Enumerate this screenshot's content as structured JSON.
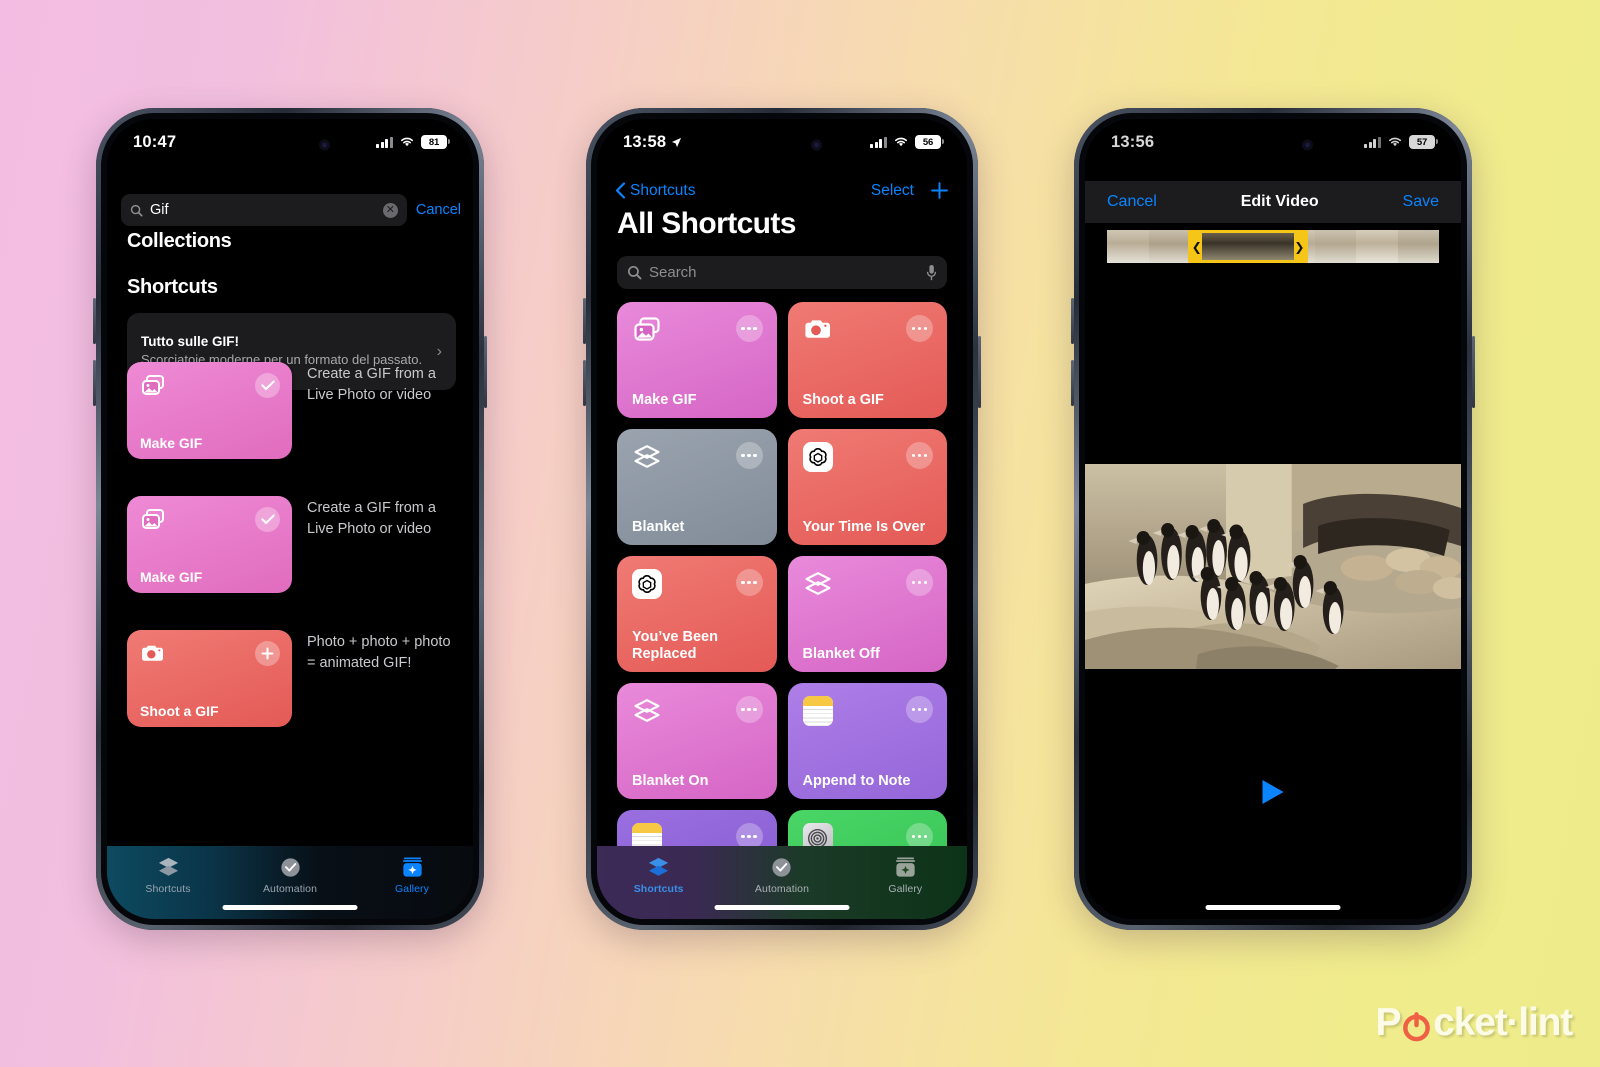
{
  "background": {
    "from": "#f3bde3",
    "to": "#f0ec8c"
  },
  "watermark": {
    "pre": "P",
    "post": "cket·lint",
    "accent": "#ef6144"
  },
  "phone1": {
    "status": {
      "time": "10:47",
      "battery": "81"
    },
    "search": {
      "value": "Gif",
      "cancel": "Cancel",
      "clear": "✕"
    },
    "collections_title": "Collections",
    "collection": {
      "name": "Tutto sulle GIF!",
      "description": "Scorciatoie moderne per un formato del passato.",
      "chevron": "›"
    },
    "shortcuts_title": "Shortcuts",
    "shortcuts": [
      {
        "name": "Make GIF",
        "description": "Create a GIF from a Live Photo or video",
        "color": "#e77cc8",
        "icon": "photos-stack-icon",
        "badge": "check"
      },
      {
        "name": "Make GIF",
        "description": "Create a GIF from a Live Photo or video",
        "color": "#e57fca",
        "icon": "photos-stack-icon",
        "badge": "check"
      },
      {
        "name": "Shoot a GIF",
        "description": "Photo + photo + photo = animated GIF!",
        "color": "#ec6763",
        "icon": "camera-icon",
        "badge": "plus"
      }
    ],
    "tabs": [
      {
        "label": "Shortcuts",
        "icon": "layers-icon",
        "active": false
      },
      {
        "label": "Automation",
        "icon": "clock-check-icon",
        "active": false
      },
      {
        "label": "Gallery",
        "icon": "gallery-sparkle-icon",
        "active": true
      }
    ]
  },
  "phone2": {
    "status": {
      "time": "13:58",
      "battery": "56"
    },
    "nav": {
      "back": "Shortcuts",
      "select": "Select",
      "add": "+"
    },
    "title": "All Shortcuts",
    "search_placeholder": "Search",
    "tiles": [
      {
        "name": "Make GIF",
        "color": "#e07ad2",
        "icon": "photos-stack-icon"
      },
      {
        "name": "Shoot a GIF",
        "color": "#ec6763",
        "icon": "camera-icon"
      },
      {
        "name": "Blanket",
        "color": "#8d96a3",
        "icon": "layers-icon"
      },
      {
        "name": "Your Time Is Over",
        "color": "#ec6763",
        "icon": "chatgpt-icon"
      },
      {
        "name": "You’ve Been Replaced",
        "color": "#ec6763",
        "icon": "chatgpt-icon"
      },
      {
        "name": "Blanket Off",
        "color": "#e07ad2",
        "icon": "layers-icon"
      },
      {
        "name": "Blanket On",
        "color": "#e07ad2",
        "icon": "layers-icon"
      },
      {
        "name": "Append to Note",
        "color": "#a471e0",
        "icon": "notes-icon"
      },
      {
        "name": "",
        "color": "#8a5fd6",
        "icon": "notes-icon"
      },
      {
        "name": "",
        "color": "#3fc75c",
        "icon": "settings-icon"
      }
    ],
    "tabs": [
      {
        "label": "Shortcuts",
        "icon": "layers-icon",
        "active": true
      },
      {
        "label": "Automation",
        "icon": "clock-check-icon",
        "active": false
      },
      {
        "label": "Gallery",
        "icon": "gallery-sparkle-icon",
        "active": false
      }
    ]
  },
  "phone3": {
    "status": {
      "time": "13:56",
      "battery": "57"
    },
    "nav": {
      "cancel": "Cancel",
      "title": "Edit Video",
      "save": "Save"
    },
    "trim": {
      "left_handle": "❮",
      "right_handle": "❯",
      "accent": "#f5c518"
    },
    "play": "play-icon"
  }
}
